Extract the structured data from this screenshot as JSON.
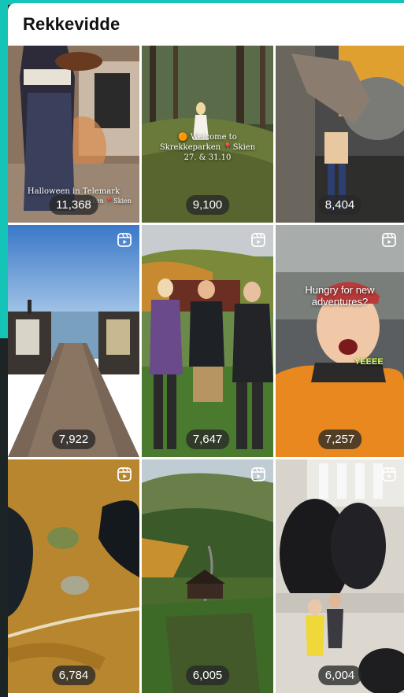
{
  "header": {
    "title": "Rekkevidde"
  },
  "tiles": [
    {
      "count": "11,368",
      "overlay": "Halloween in Telemark",
      "overlay2": "rken 📍Skien",
      "reel": false
    },
    {
      "count": "9,100",
      "overlay": "🟠 Welcome to",
      "overlay2": "Skrekkeparken 📍Skien",
      "overlay3": "27. & 31.10",
      "reel": false
    },
    {
      "count": "8,404",
      "reel": false
    },
    {
      "count": "7,922",
      "reel": true
    },
    {
      "count": "7,647",
      "reel": true
    },
    {
      "count": "7,257",
      "overlay": "Hungry for new adventures?",
      "overlay2": "YEEEE",
      "reel": true
    },
    {
      "count": "6,784",
      "reel": true
    },
    {
      "count": "6,005",
      "reel": true
    },
    {
      "count": "6,004",
      "reel": true
    }
  ]
}
